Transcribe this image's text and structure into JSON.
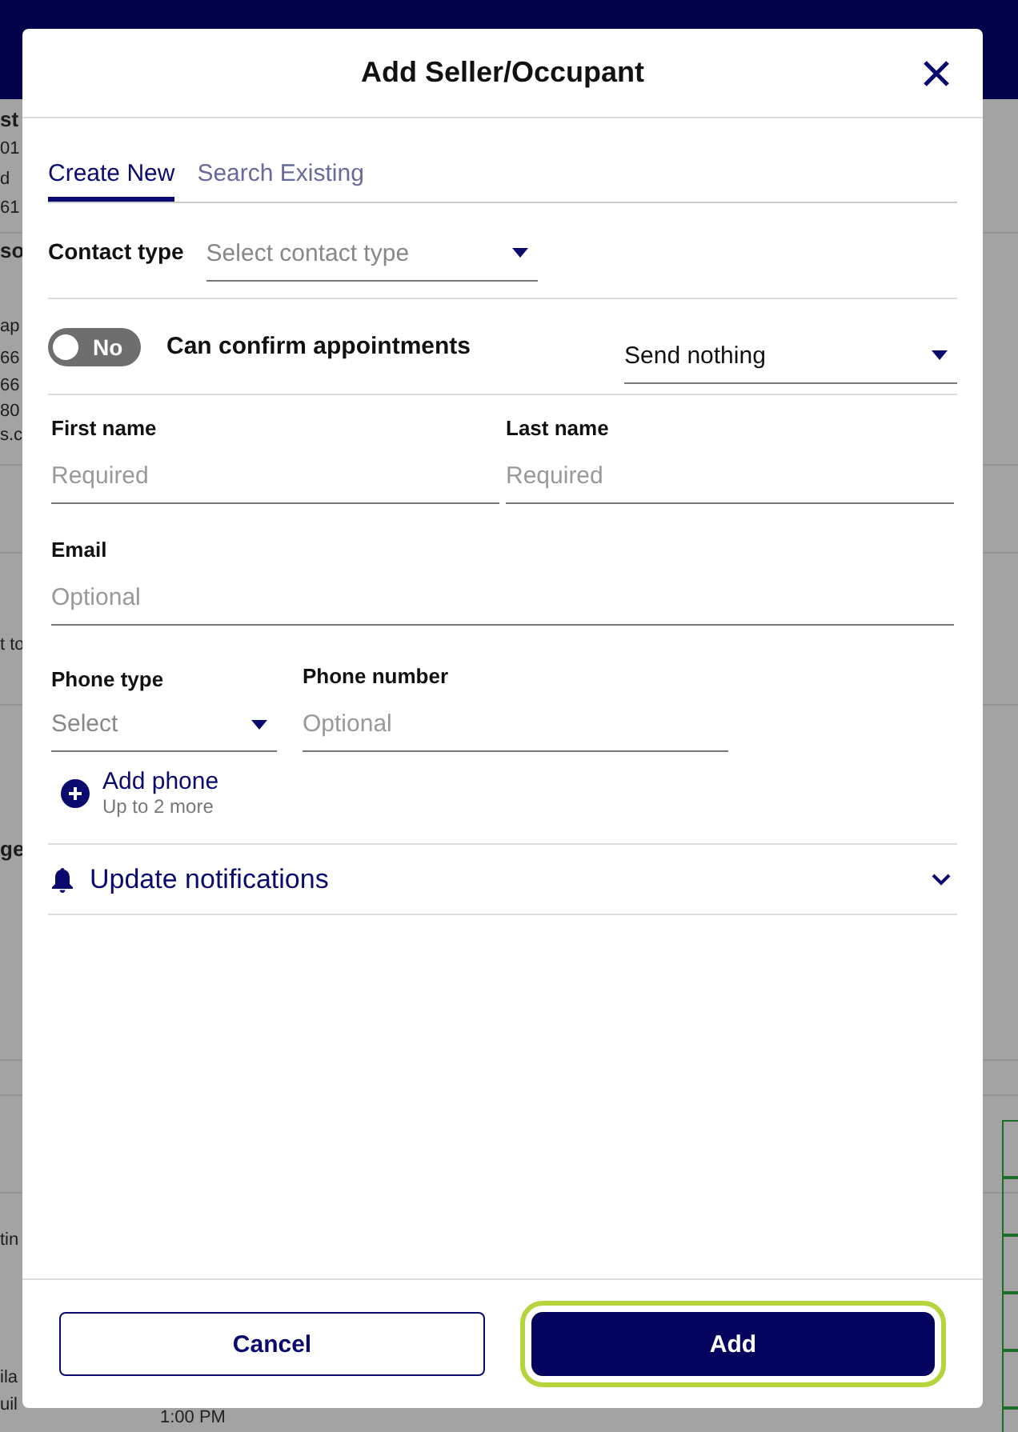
{
  "background": {
    "fragments": [
      {
        "text": "st",
        "bold": true
      },
      {
        "text": "01",
        "bold": false
      },
      {
        "text": "d",
        "bold": false
      },
      {
        "text": "61",
        "bold": false
      },
      {
        "text": "so",
        "bold": true
      },
      {
        "text": "ap",
        "bold": false
      },
      {
        "text": "66",
        "bold": false
      },
      {
        "text": "66",
        "bold": false
      },
      {
        "text": "80",
        "bold": false
      },
      {
        "text": "s.c",
        "bold": false
      },
      {
        "text": "t to",
        "bold": false
      },
      {
        "text": "ge",
        "bold": true
      },
      {
        "text": "tin",
        "bold": false
      },
      {
        "text": "ila",
        "bold": false
      },
      {
        "text": "uil",
        "bold": false
      }
    ],
    "time": "1:00 PM"
  },
  "dialog": {
    "title": "Add Seller/Occupant",
    "tabs": [
      {
        "label": "Create New",
        "selected": true
      },
      {
        "label": "Search Existing",
        "selected": false
      }
    ],
    "contact_type": {
      "label": "Contact type",
      "placeholder": "Select contact type"
    },
    "confirm": {
      "toggle_on": false,
      "toggle_label": "No",
      "label": "Can confirm appointments",
      "select_value": "Send nothing"
    },
    "name_fields": [
      {
        "label": "First name",
        "placeholder": "Required"
      },
      {
        "label": "Last name",
        "placeholder": "Required"
      }
    ],
    "email": {
      "label": "Email",
      "placeholder": "Optional"
    },
    "phone_type": {
      "label": "Phone type",
      "placeholder": "Select"
    },
    "phone_number": {
      "label": "Phone number",
      "placeholder": "Optional"
    },
    "add_phone": {
      "label": "Add phone",
      "hint": "Up to 2 more"
    },
    "notifications": {
      "label": "Update notifications",
      "expanded": false
    },
    "buttons": [
      {
        "label": "Cancel",
        "kind": "secondary",
        "focused": false
      },
      {
        "label": "Add",
        "kind": "primary",
        "focused": true
      }
    ]
  }
}
